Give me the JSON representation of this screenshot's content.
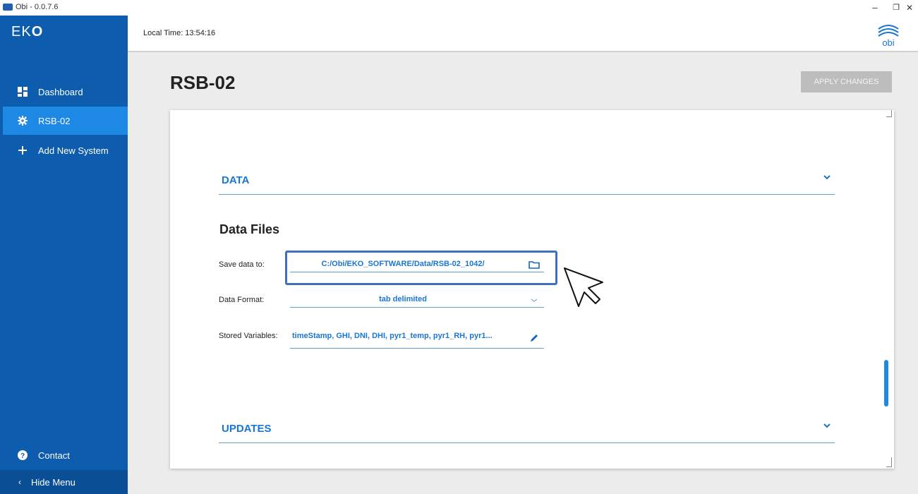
{
  "window": {
    "title": "Obi - 0.0.7.6",
    "minimize_glyph": "–",
    "maximize_glyph": "❐",
    "close_glyph": "✕"
  },
  "sidebar": {
    "logo_prefix": "EK",
    "logo_suffix": "O",
    "items": [
      {
        "label": "Dashboard",
        "icon": "dashboard-icon"
      },
      {
        "label": "RSB-02",
        "icon": "gear-icon",
        "active": true
      },
      {
        "label": "Add New System",
        "icon": "plus-icon"
      }
    ],
    "contact_label": "Contact",
    "hide_menu_label": "Hide Menu"
  },
  "topbar": {
    "local_time": "Local Time: 13:54:16",
    "brand": "obi"
  },
  "page": {
    "title": "RSB-02",
    "apply_label": "APPLY CHANGES"
  },
  "sections": {
    "data_label": "DATA",
    "updates_label": "UPDATES"
  },
  "data_files": {
    "title": "Data Files",
    "save_label": "Save data to:",
    "save_value": "C:/Obi/EKO_SOFTWARE/Data/RSB-02_1042/",
    "format_label": "Data Format:",
    "format_value": "tab delimited",
    "vars_label": "Stored Variables:",
    "vars_value": "timeStamp, GHI, DNI, DHI, pyr1_temp, pyr1_RH, pyr1..."
  },
  "colors": {
    "sidebar": "#0d5cad",
    "active": "#1e88e5",
    "accent": "#1976d2",
    "highlight": "#3f6fbf"
  }
}
